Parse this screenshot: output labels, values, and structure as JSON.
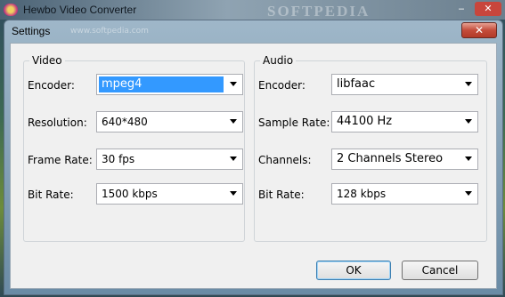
{
  "app": {
    "title": "Hewbo Video Converter",
    "watermark": "SOFTPEDIA"
  },
  "dialog": {
    "title": "Settings",
    "watermark": "www.softpedia.com",
    "close_label": "✕"
  },
  "video": {
    "legend": "Video",
    "encoder_label": "Encoder:",
    "encoder_value": "mpeg4",
    "resolution_label": "Resolution:",
    "resolution_value": "640*480",
    "framerate_label": "Frame Rate:",
    "framerate_value": "30 fps",
    "bitrate_label": "Bit Rate:",
    "bitrate_value": "1500 kbps"
  },
  "audio": {
    "legend": "Audio",
    "encoder_label": "Encoder:",
    "encoder_value": "libfaac",
    "samplerate_label": "Sample Rate:",
    "samplerate_value": "44100 Hz",
    "channels_label": "Channels:",
    "channels_value": "2 Channels Stereo",
    "bitrate_label": "Bit Rate:",
    "bitrate_value": "128 kbps"
  },
  "buttons": {
    "ok": "OK",
    "cancel": "Cancel"
  },
  "window_controls": {
    "minimize": "‒",
    "close": "✕"
  }
}
